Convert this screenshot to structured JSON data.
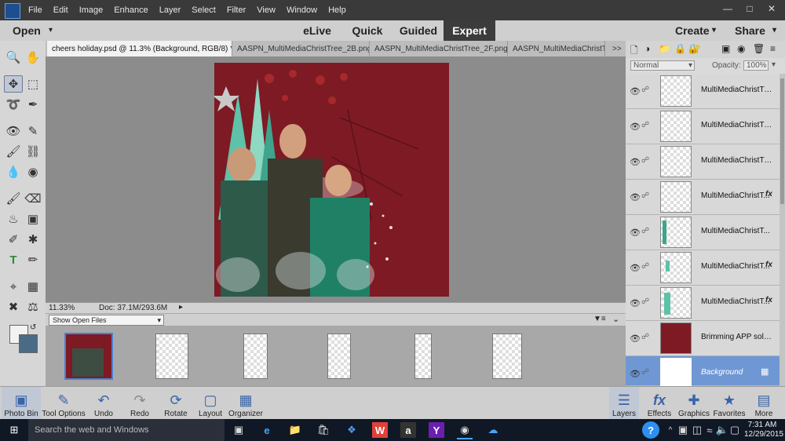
{
  "menubar": {
    "items": [
      "File",
      "Edit",
      "Image",
      "Enhance",
      "Layer",
      "Select",
      "Filter",
      "View",
      "Window",
      "Help"
    ]
  },
  "modebar": {
    "open_label": "Open",
    "modes": [
      "eLive",
      "Quick",
      "Guided",
      "Expert"
    ],
    "active_mode": "Expert",
    "create_label": "Create",
    "share_label": "Share"
  },
  "tabs": [
    "cheers holiday.psd @ 11.3% (Background, RGB/8) *",
    "AASPN_MultiMediaChristTree_2B.png",
    "AASPN_MultiMediaChristTree_2F.png",
    "AASPN_MultiMediaChristTre"
  ],
  "tabs_overflow": ">>",
  "status": {
    "zoom": "11.33%",
    "doc": "Doc: 37.1M/293.6M"
  },
  "photobin": {
    "select_value": "Show Open Files"
  },
  "layers_panel": {
    "blend_mode": "Normal",
    "opacity_label": "Opacity:",
    "opacity_value": "100%",
    "layers": [
      {
        "name": "MultiMediaChristTree...",
        "fx": ""
      },
      {
        "name": "MultiMediaChristTree...",
        "fx": ""
      },
      {
        "name": "MultiMediaChristTree...",
        "fx": ""
      },
      {
        "name": "MultiMediaChristT...",
        "fx": "fx"
      },
      {
        "name": "MultiMediaChristT...",
        "fx": ""
      },
      {
        "name": "MultiMediaChristT...",
        "fx": "fx"
      },
      {
        "name": "MultiMediaChristT...",
        "fx": "fx"
      },
      {
        "name": "Brimming APP solid p...",
        "fx": ""
      },
      {
        "name": "Background",
        "fx": ""
      }
    ],
    "solid_color": "#7d1a24",
    "active_color": "#6f97d3"
  },
  "bottombar": {
    "left": [
      "Photo Bin",
      "Tool Options",
      "Undo",
      "Redo",
      "Rotate",
      "Layout",
      "Organizer"
    ],
    "right": [
      "Layers",
      "Effects",
      "Graphics",
      "Favorites",
      "More"
    ]
  },
  "taskbar": {
    "search_placeholder": "Search the web and Windows",
    "time": "7:31 AM",
    "date": "12/29/2015"
  }
}
